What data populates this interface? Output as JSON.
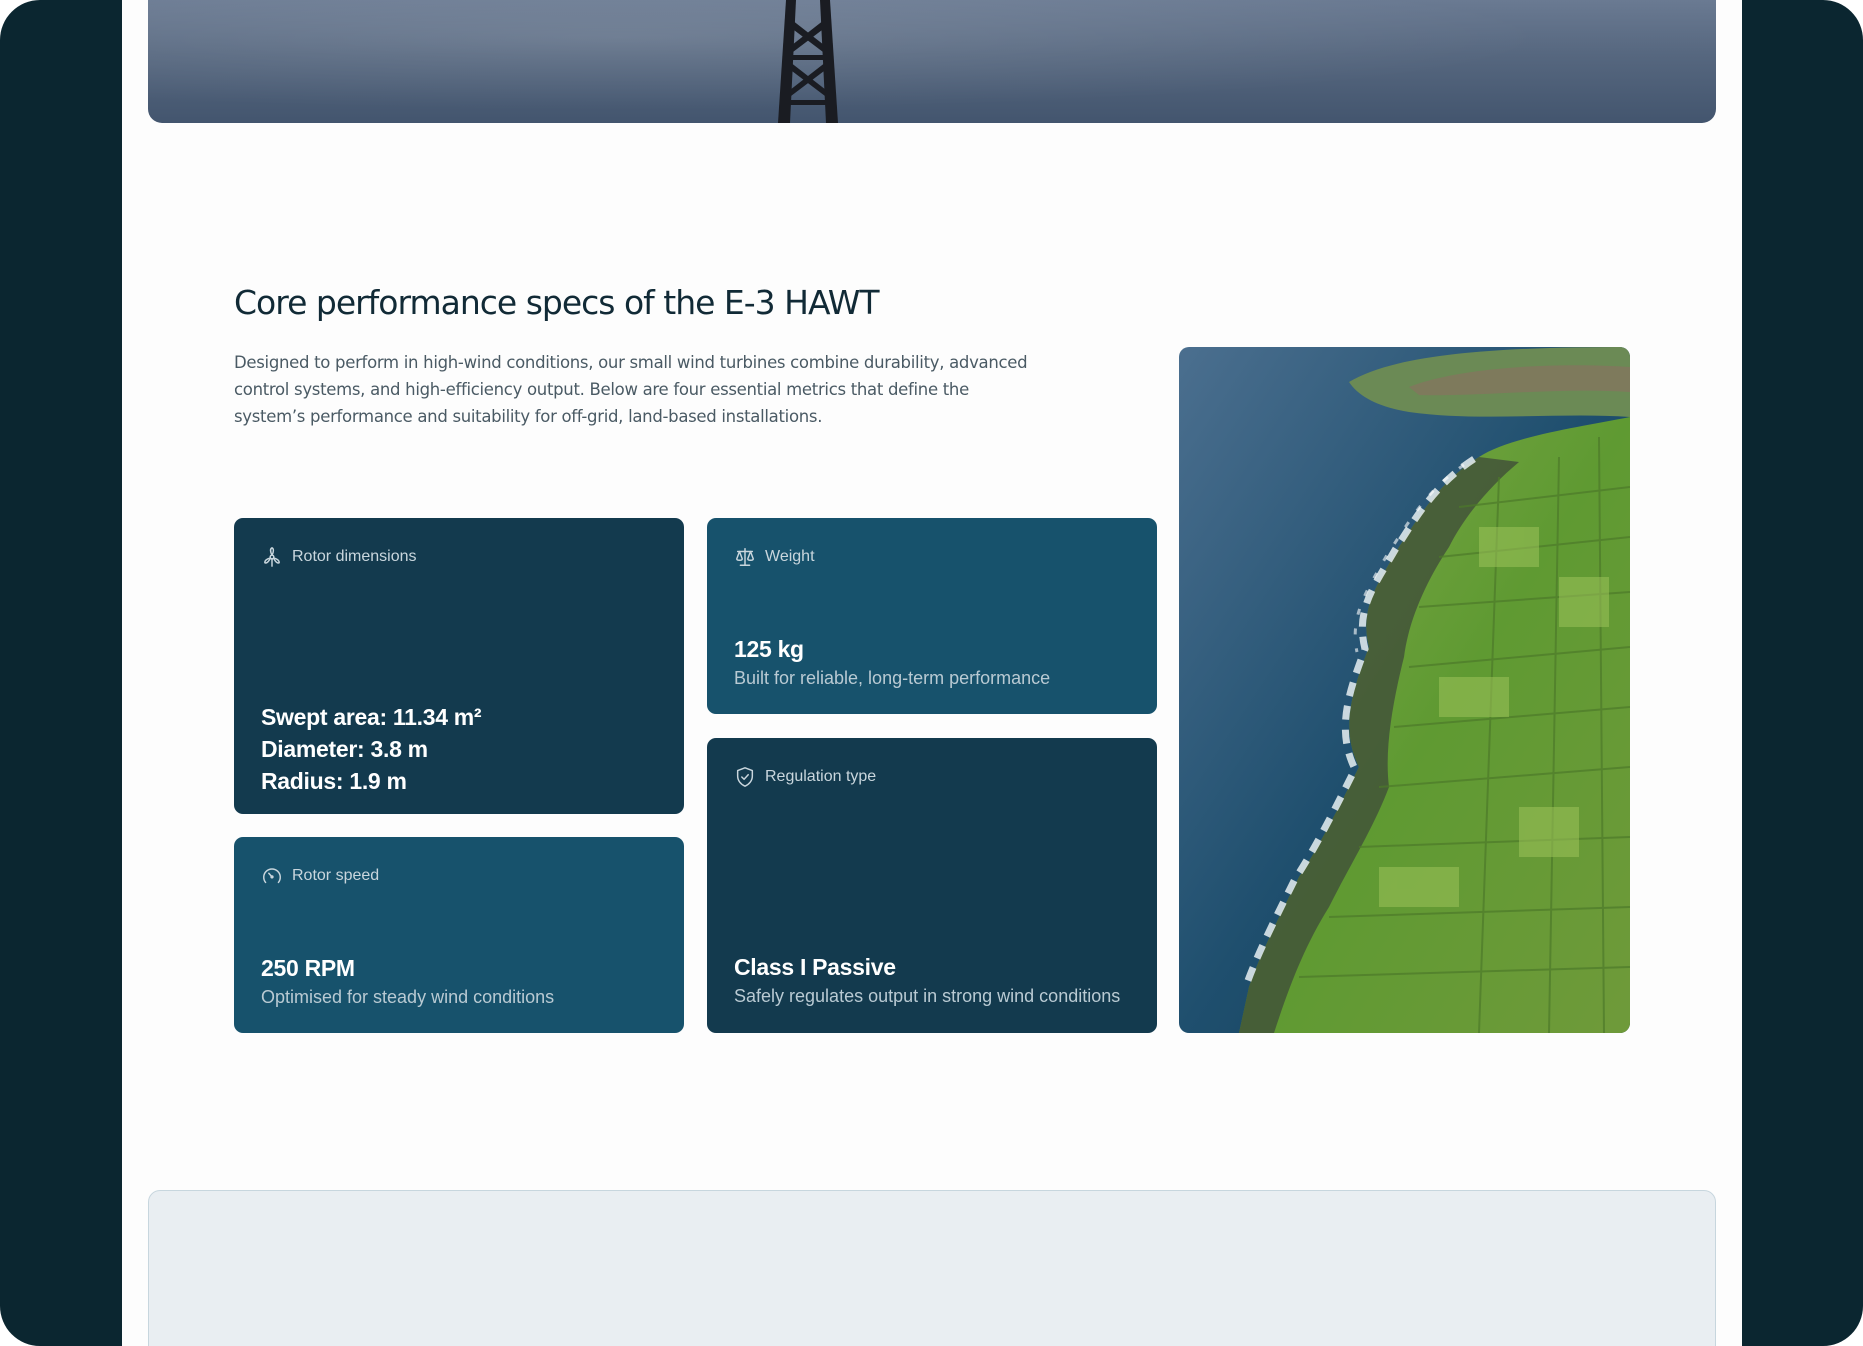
{
  "section": {
    "title": "Core performance specs of the E-3 HAWT",
    "description": "Designed to perform in high-wind conditions, our small wind turbines combine durability, advanced control systems, and high-efficiency output. Below are four essential metrics that define the system’s performance and suitability for off-grid, land-based installations."
  },
  "cards": {
    "rotor_dimensions": {
      "icon": "turbine-icon",
      "label": "Rotor dimensions",
      "swept_area": "Swept area: 11.34 m²",
      "diameter": "Diameter: 3.8 m",
      "radius": "Radius: 1.9 m"
    },
    "weight": {
      "icon": "scale-icon",
      "label": "Weight",
      "value": "125 kg",
      "subtitle": "Built for reliable, long-term performance"
    },
    "rotor_speed": {
      "icon": "gauge-icon",
      "label": "Rotor speed",
      "value": "250 RPM",
      "subtitle": "Optimised for steady wind conditions"
    },
    "regulation_type": {
      "icon": "shield-check-icon",
      "label": "Regulation type",
      "value": "Class I Passive",
      "subtitle": "Safely regulates output in strong wind conditions"
    }
  },
  "colors": {
    "frame": "#0b2630",
    "card_dark": "#133a4e",
    "card_mid": "#17526c",
    "title": "#112a36"
  }
}
